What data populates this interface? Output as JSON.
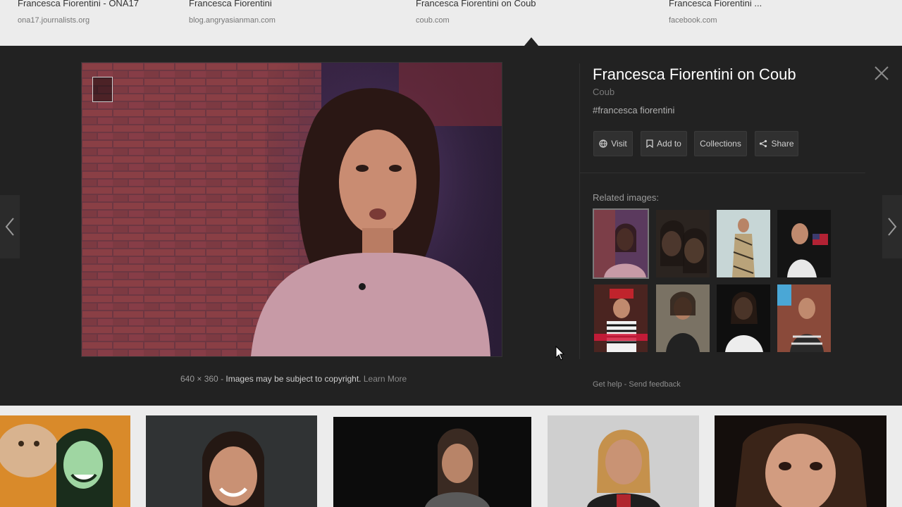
{
  "top_results": [
    {
      "title": "Francesca Fiorentini - ONA17",
      "url": "ona17.journalists.org"
    },
    {
      "title": "Francesca Fiorentini",
      "url": "blog.angryasianman.com"
    },
    {
      "title": "Francesca Fiorentini on Coub",
      "url": "coub.com"
    },
    {
      "title": "Francesca Fiorentini ...",
      "url": "facebook.com"
    }
  ],
  "viewer": {
    "title": "Francesca Fiorentini on Coub",
    "source": "Coub",
    "tag": "#francesca fiorentini",
    "buttons": {
      "visit": "Visit",
      "add_to": "Add to",
      "collections": "Collections",
      "share": "Share"
    },
    "related_label": "Related images:",
    "caption": {
      "dimensions": "640 × 360",
      "sep": "-",
      "notice": "Images may be subject to copyright.",
      "learn_more": "Learn More"
    },
    "footer": {
      "help": "Get help",
      "sep": "-",
      "feedback": "Send feedback"
    }
  },
  "icons": {
    "prev": "chevron-left-icon",
    "next": "chevron-right-icon",
    "close": "close-icon",
    "visit": "globe-icon",
    "add_to": "bookmark-icon",
    "share": "share-icon"
  },
  "colors": {
    "viewer_bg": "#222222",
    "strip_bg": "#ececec",
    "title": "#ffffff",
    "button_bg": "#303030"
  }
}
